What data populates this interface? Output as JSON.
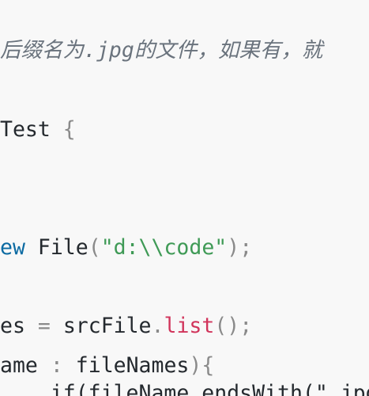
{
  "editor": {
    "comment_prefix": "后缀名为",
    "comment_ext": ".jpg",
    "comment_suffix": "的文件，如果有，就",
    "class_name": "Test",
    "class_brace": "{",
    "new_keyword": "ew",
    "file_type": "File",
    "paren_open": "(",
    "path_string": "\"d:\\\\code\"",
    "paren_close_semi": ");",
    "array_var_tail": "es",
    "assign_op": "=",
    "src_var": "srcFile",
    "dot": ".",
    "list_method": "list",
    "call_end": "();",
    "loop_var_tail": "ame",
    "colon": ":",
    "array_name": "fileNames",
    "loop_close": "){",
    "partial_line": "    if(fileName.endsWith(\".jpg\")){"
  }
}
